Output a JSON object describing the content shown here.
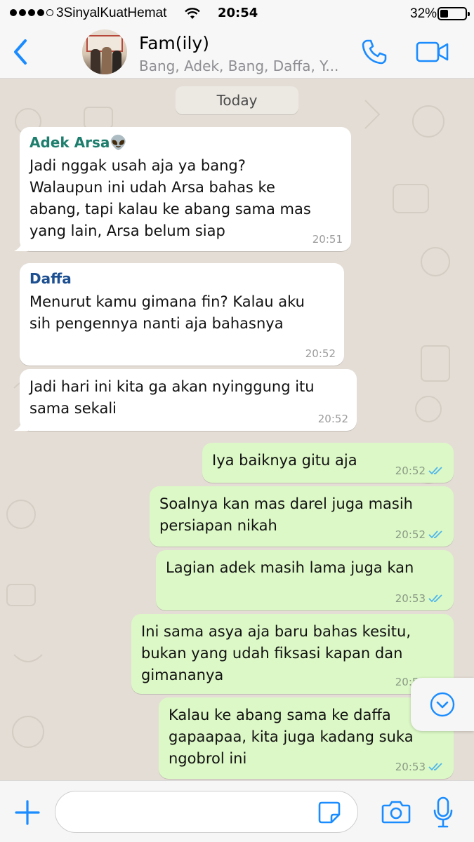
{
  "status_bar": {
    "carrier": "3SinyalKuatHemat",
    "time": "20:54",
    "battery_percent_label": "32%",
    "battery_level": 0.32
  },
  "header": {
    "title": "Fam(ily)",
    "subtitle": "Bang, Adek, Bang, Daffa, Y..."
  },
  "chat": {
    "date_label": "Today",
    "messages": [
      {
        "direction": "in",
        "sender": "Adek Arsa👽",
        "sender_color": "#1d7e6d",
        "text": "Jadi nggak usah aja ya bang?\nWalaupun ini udah Arsa bahas ke\nabang, tapi kalau ke abang sama mas\nyang lain, Arsa belum siap",
        "time": "20:51"
      },
      {
        "direction": "in",
        "sender": "Daffa",
        "sender_color": "#1c4f91",
        "text": "Menurut kamu gimana fin? Kalau aku\nsih pengennya nanti aja bahasnya",
        "time": "20:52"
      },
      {
        "direction": "in",
        "sender": "",
        "text": "Jadi hari ini kita ga akan nyinggung itu\nsama sekali",
        "time": "20:52"
      },
      {
        "direction": "out",
        "text": "Iya baiknya gitu aja",
        "time": "20:52",
        "status": "read"
      },
      {
        "direction": "out",
        "text": "Soalnya kan mas darel juga masih\npersiapan nikah",
        "time": "20:52",
        "status": "read"
      },
      {
        "direction": "out",
        "text": "Lagian adek masih lama juga kan",
        "time": "20:53",
        "status": "read"
      },
      {
        "direction": "out",
        "text": "Ini sama asya aja baru bahas kesitu,\nbukan yang udah fiksasi kapan dan\ngimananya",
        "time": "20:53",
        "status": "read"
      },
      {
        "direction": "out",
        "text": "Kalau ke abang sama ke daffa\ngapaapaa, kita juga kadang suka\nngobrol ini",
        "time": "20:53",
        "status": "read"
      }
    ]
  },
  "composer": {
    "input_value": "",
    "input_placeholder": ""
  },
  "colors": {
    "accent": "#1a8cff",
    "incoming_bubble": "#ffffff",
    "outgoing_bubble": "#dcf8c6",
    "read_ticks": "#4fb6ec",
    "wallpaper": "#e4ddd5"
  },
  "icons": [
    "back-chevron-icon",
    "phone-icon",
    "video-camera-icon",
    "scroll-down-icon",
    "plus-icon",
    "sticker-icon",
    "camera-icon",
    "microphone-icon"
  ]
}
